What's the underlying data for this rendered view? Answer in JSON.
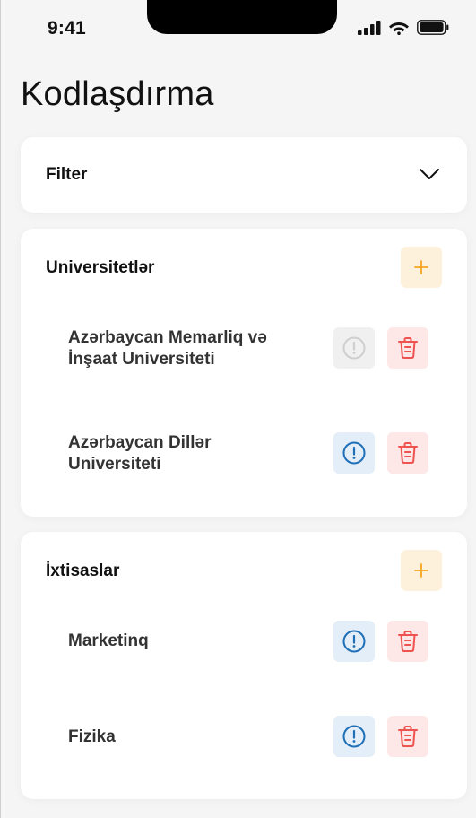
{
  "status_bar": {
    "time": "9:41"
  },
  "page": {
    "title": "Kodlaşdırma"
  },
  "filter": {
    "label": "Filter"
  },
  "universities": {
    "title": "Universitetlər",
    "items": [
      {
        "name": "Azərbaycan Memarliq və İnşaat Universiteti",
        "info_enabled": false
      },
      {
        "name": "Azərbaycan Dillər Universiteti",
        "info_enabled": true
      }
    ]
  },
  "specialties": {
    "title": "İxtisaslar",
    "items": [
      {
        "name": "Marketinq",
        "info_enabled": true
      },
      {
        "name": "Fizika",
        "info_enabled": true
      }
    ]
  },
  "colors": {
    "add_accent": "#f5a623",
    "info_accent": "#1f6fb8",
    "info_disabled": "#cfcfcf",
    "delete_accent": "#ef5350"
  },
  "icons": {
    "add": "plus-icon",
    "info": "exclamation-circle-icon",
    "delete": "trash-icon",
    "filter_toggle": "chevron-down-icon"
  }
}
